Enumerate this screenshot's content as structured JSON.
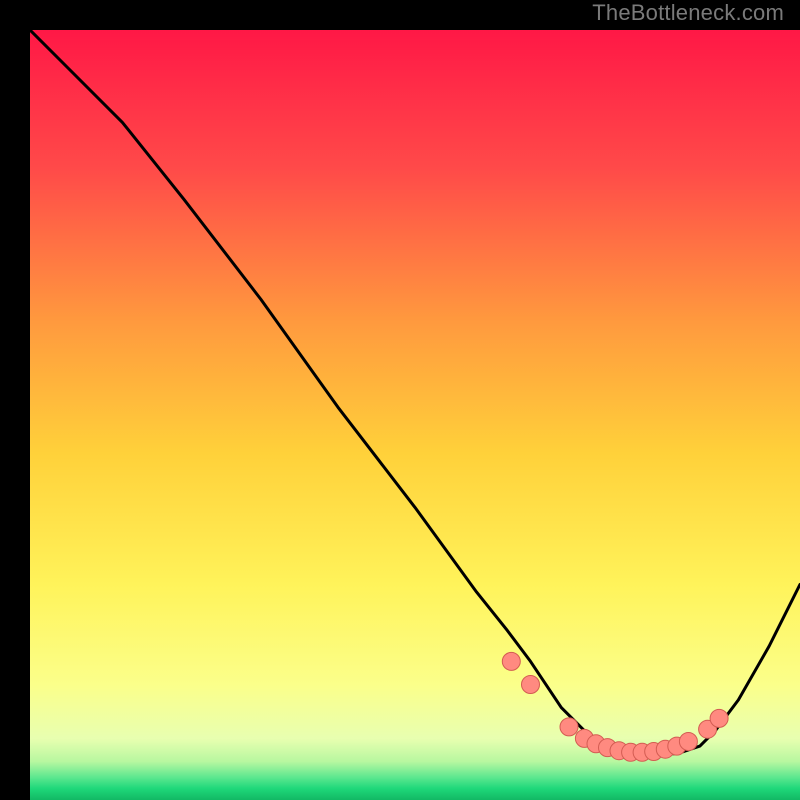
{
  "watermark": "TheBottleneck.com",
  "colors": {
    "gradient_top": "#ff1846",
    "gradient_mid_upper": "#ff7a3c",
    "gradient_mid": "#ffd33a",
    "gradient_mid_lower": "#fff56a",
    "gradient_low": "#f6ffaf",
    "gradient_green": "#1fe07a",
    "line": "#000000",
    "dot": "#ff8a80",
    "dot_stroke": "#d35c52",
    "frame": "#000000"
  },
  "chart_data": {
    "type": "line",
    "title": "",
    "xlabel": "",
    "ylabel": "",
    "xlim": [
      0,
      100
    ],
    "ylim": [
      0,
      100
    ],
    "series": [
      {
        "name": "bottleneck-curve",
        "x": [
          0,
          5,
          12,
          20,
          30,
          40,
          50,
          58,
          62,
          65,
          69,
          72,
          75,
          78,
          81,
          84,
          87,
          89,
          92,
          96,
          100
        ],
        "y": [
          100,
          95,
          88,
          78,
          65,
          51,
          38,
          27,
          22,
          18,
          12,
          9,
          7,
          6,
          6,
          6,
          7,
          9,
          13,
          20,
          28
        ]
      }
    ],
    "dots": {
      "name": "optimal-range-dots",
      "x": [
        62.5,
        65,
        70,
        72,
        73.5,
        75,
        76.5,
        78,
        79.5,
        81,
        82.5,
        84,
        85.5,
        88,
        89.5
      ],
      "y": [
        18,
        15,
        9.5,
        8,
        7.3,
        6.8,
        6.4,
        6.2,
        6.2,
        6.3,
        6.6,
        7.0,
        7.6,
        9.2,
        10.6
      ]
    }
  }
}
